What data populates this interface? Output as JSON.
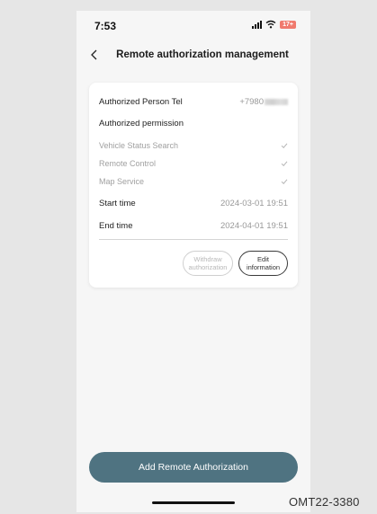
{
  "status_bar": {
    "time": "7:53",
    "battery_level": "17+",
    "icons": [
      "signal-icon",
      "wifi-icon",
      "battery-icon"
    ]
  },
  "nav": {
    "back_icon": "chevron-left-icon",
    "title": "Remote authorization management"
  },
  "card": {
    "tel_label": "Authorized Person Tel",
    "tel_value_visible": "+7980",
    "permission_label": "Authorized permission",
    "permissions": [
      {
        "label": "Vehicle Status Search",
        "checked": true
      },
      {
        "label": "Remote Control",
        "checked": true
      },
      {
        "label": "Map Service",
        "checked": true
      }
    ],
    "start_label": "Start time",
    "start_value": "2024-03-01 19:51",
    "end_label": "End time",
    "end_value": "2024-04-01 19:51",
    "withdraw_line1": "Withdraw",
    "withdraw_line2": "authorization",
    "edit_line1": "Edit",
    "edit_line2": "information"
  },
  "add_button_label": "Add Remote Authorization",
  "figure_code": "OMT22-3380",
  "colors": {
    "accent_button": "#4f7381",
    "battery": "#f07a6e",
    "background": "#e6e6e6"
  }
}
